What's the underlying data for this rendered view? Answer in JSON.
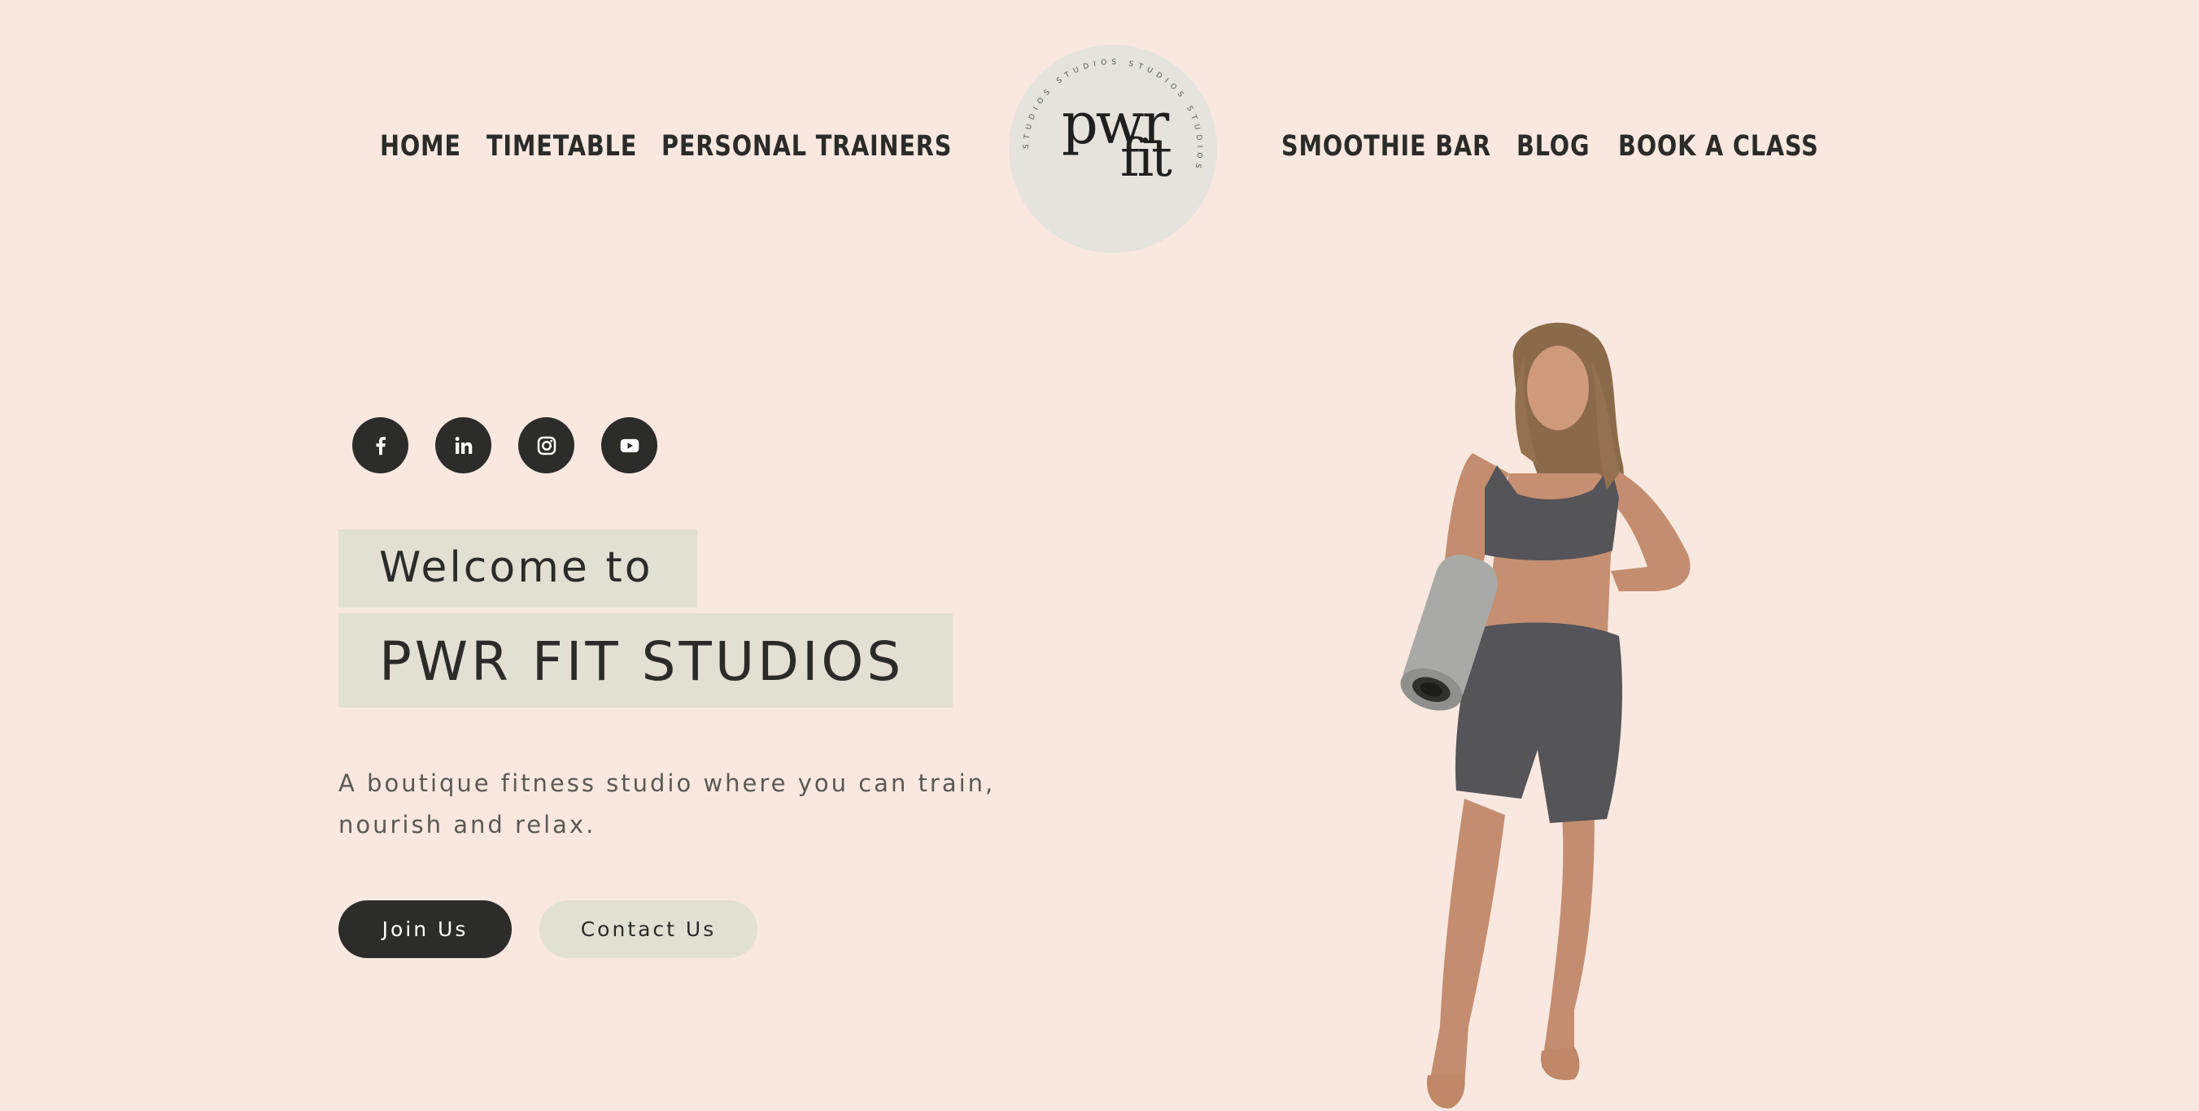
{
  "nav": {
    "left": [
      "HOME",
      "TIMETABLE",
      "PERSONAL TRAINERS"
    ],
    "right": [
      "SMOOTHIE BAR",
      "BLOG",
      "BOOK A CLASS"
    ]
  },
  "logo": {
    "line1": "pwr",
    "line2": "fit",
    "ring_text": "STUDIOS STUDIOS STUDIOS STUDIOS"
  },
  "social": [
    {
      "name": "facebook-icon"
    },
    {
      "name": "linkedin-icon"
    },
    {
      "name": "instagram-icon"
    },
    {
      "name": "youtube-icon"
    }
  ],
  "hero": {
    "welcome": "Welcome to",
    "title": "PWR FIT STUDIOS",
    "description": "A boutique fitness studio where you can train, nourish and relax.",
    "join_label": "Join Us",
    "contact_label": "Contact Us"
  },
  "colors": {
    "background": "#f9e8df",
    "dark": "#2c2c29",
    "beige": "#e2dfd3",
    "logo_circle": "#e5e3dc"
  }
}
